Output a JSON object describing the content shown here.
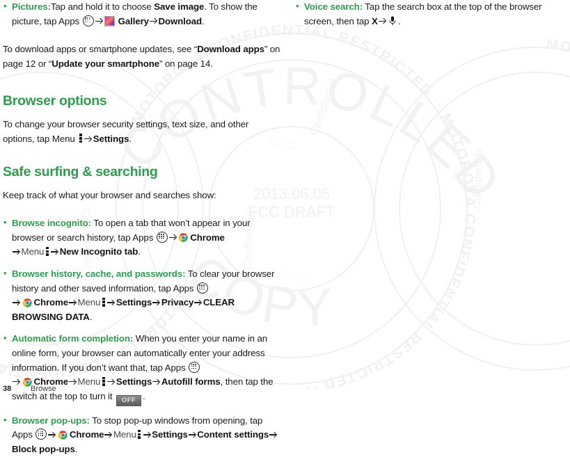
{
  "page": {
    "number": "38",
    "running_head": "Browse"
  },
  "watermark": {
    "date": "2013.06.05",
    "draft": "FCC DRAFT",
    "big_arc_1": "CONTROLLED",
    "big_arc_2": "COPY",
    "ring_text": "MOTOROLA CONFIDENTIAL RESTRICTED ::",
    "small_text": "Confidential",
    "color": "#f2f2f2"
  },
  "colors": {
    "accent_green": "#2e9b4e",
    "body_text": "#1b1b1b",
    "menu_gray": "#4a4a4a"
  },
  "left_column": {
    "pictures_bullet": {
      "lead": "Pictures:",
      "t1": "Tap and hold it to choose ",
      "b1": "Save image",
      "t2": ". To show the picture, tap Apps ",
      "icon_apps": "apps-icon",
      "icon_gallery": "gallery-icon",
      "b2": "Gallery",
      "b3": "Download",
      "t3": "."
    },
    "download_paragraph": {
      "t1": "To download apps or smartphone updates, see “",
      "b1": "Download apps",
      "t2": "” on page 12 or “",
      "b2": "Update your smartphone",
      "t3": "” on page 14."
    },
    "browser_options": {
      "heading": "Browser options",
      "t1": "To change your browser security settings, text size, and other options, tap Menu ",
      "icon_menu": "menu-icon",
      "b1": "Settings",
      "t2": "."
    },
    "safe_surfing": {
      "heading": "Safe surfing & searching",
      "intro": "Keep track of what your browser and searches show:"
    },
    "bullets": [
      {
        "lead": "Browse incognito:",
        "t1": "To open a tab that won’t appear in your browser or search history, tap Apps ",
        "b1": "Chrome",
        "menu_word": "Menu",
        "b2": "New Incognito tab",
        "t2": "."
      },
      {
        "lead": "Browser history, cache, and passwords:",
        "t1": "To clear your browser history and other saved information, tap Apps ",
        "b1": "Chrome",
        "menu_word": "Menu",
        "b2": "Settings",
        "b3": "Privacy",
        "b4": "CLEAR BROWSING DATA",
        "t2": "."
      },
      {
        "lead": "Automatic form completion:",
        "t1": "When you enter your name in an online form, your browser can automatically enter your address information. If you don’t want that, tap Apps ",
        "b1": "Chrome",
        "menu_word": "Menu",
        "b2": "Settings",
        "b3": "Autofill forms",
        "t2": ", then tap the switch at the top to turn it ",
        "switch_label": "OFF",
        "t3": "."
      },
      {
        "lead": "Browser pop-ups:",
        "t1": "To stop pop-up windows from opening, tap Apps ",
        "b1": "Chrome",
        "menu_word": "Menu",
        "b2": "Settings",
        "b3": "Content settings",
        "b4": "Block pop-ups",
        "t2": "."
      }
    ]
  },
  "right_column": {
    "bullets": [
      {
        "lead": "Voice search:",
        "t1": "Tap the search box at the top of the browser screen, then tap ",
        "b1": "X",
        "icon_mic": "microphone-icon",
        "t2": "."
      }
    ]
  }
}
